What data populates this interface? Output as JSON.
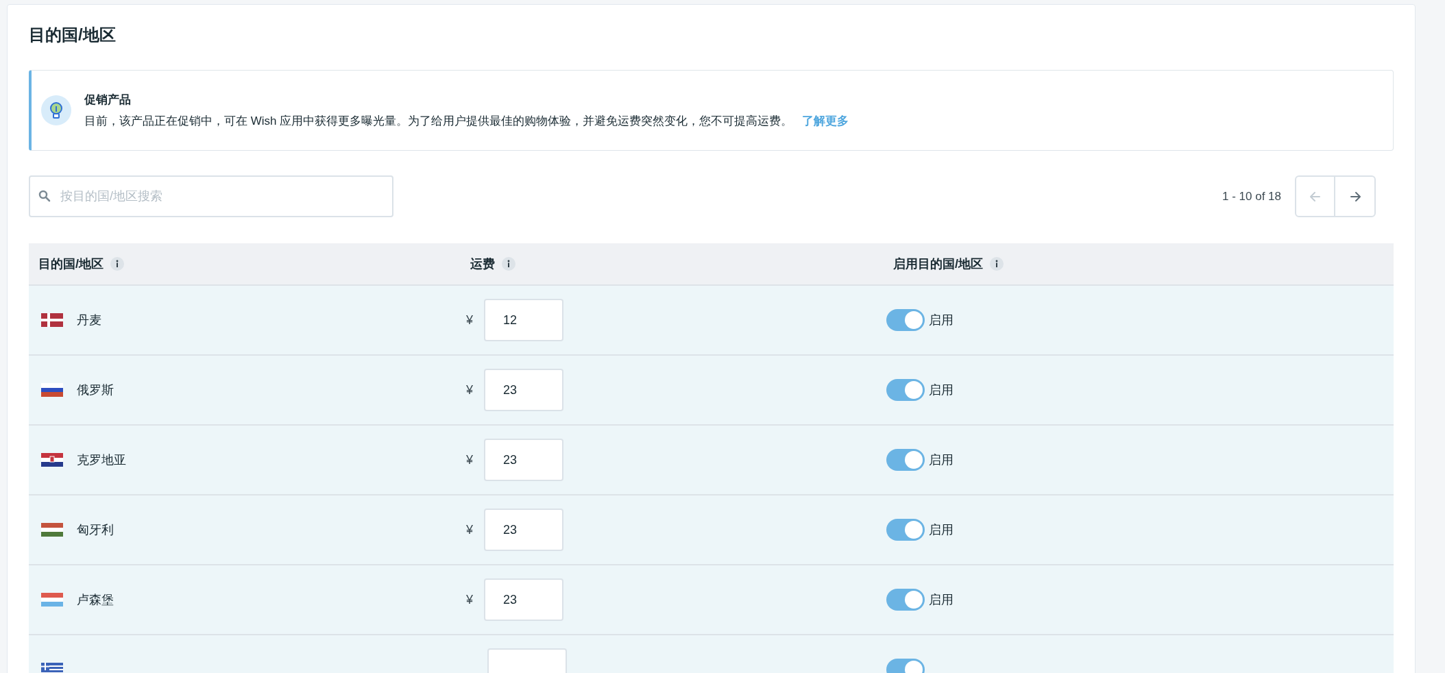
{
  "title": "目的国/地区",
  "notice": {
    "title": "促销产品",
    "text": "目前，该产品正在促销中，可在 Wish 应用中获得更多曝光量。为了给用户提供最佳的购物体验，并避免运费突然变化，您不可提高运费。",
    "link": "了解更多"
  },
  "search": {
    "placeholder": "按目的国/地区搜索"
  },
  "pagination": {
    "range": "1 - 10 of 18",
    "prev_disabled": true,
    "next_disabled": false
  },
  "table": {
    "columns": [
      "目的国/地区",
      "运费",
      "启用目的国/地区"
    ],
    "rows": [
      {
        "kind": "denmark",
        "country": "丹麦",
        "currency": "¥",
        "price": "12",
        "enabled": true,
        "toggle_label": "启用"
      },
      {
        "kind": "russia",
        "country": "俄罗斯",
        "currency": "¥",
        "price": "23",
        "enabled": true,
        "toggle_label": "启用"
      },
      {
        "kind": "croatia",
        "country": "克罗地亚",
        "currency": "¥",
        "price": "23",
        "enabled": true,
        "toggle_label": "启用"
      },
      {
        "kind": "hungary",
        "country": "匈牙利",
        "currency": "¥",
        "price": "23",
        "enabled": true,
        "toggle_label": "启用"
      },
      {
        "kind": "luxembourg",
        "country": "卢森堡",
        "currency": "¥",
        "price": "23",
        "enabled": true,
        "toggle_label": "启用"
      },
      {
        "kind": "greece",
        "enabled": true
      }
    ]
  }
}
